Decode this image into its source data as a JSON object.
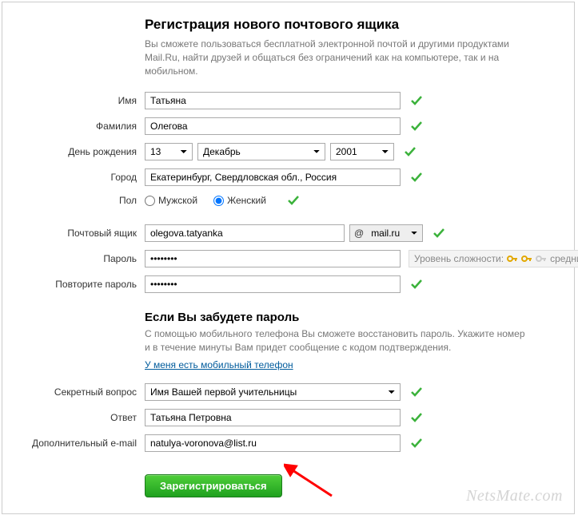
{
  "header": {
    "title": "Регистрация нового почтового ящика",
    "intro": "Вы сможете пользоваться бесплатной электронной почтой и другими продуктами Mail.Ru, найти друзей и общаться без ограничений как на компьютере, так и на мобильном."
  },
  "labels": {
    "first_name": "Имя",
    "last_name": "Фамилия",
    "birthday": "День рождения",
    "city": "Город",
    "gender": "Пол",
    "mailbox": "Почтовый ящик",
    "password": "Пароль",
    "password_repeat": "Повторите пароль",
    "secret_question": "Секретный вопрос",
    "answer": "Ответ",
    "extra_email": "Дополнительный e-mail"
  },
  "values": {
    "first_name": "Татьяна",
    "last_name": "Олегова",
    "day": "13",
    "month": "Декабрь",
    "year": "2001",
    "city": "Екатеринбург, Свердловская обл., Россия",
    "mailbox": "olegova.tatyanka",
    "domain_at": "@",
    "domain": "mail.ru",
    "password": "••••••••",
    "password_repeat": "••••••••",
    "secret_question": "Имя Вашей первой учительницы",
    "answer": "Татьяна Петровна",
    "extra_email": "natulya-voronova@list.ru"
  },
  "gender": {
    "male": "Мужской",
    "female": "Женский",
    "selected": "female"
  },
  "forgot": {
    "title": "Если Вы забудете пароль",
    "text": "С помощью мобильного телефона Вы сможете восстановить пароль. Укажите номер и в течение минуты Вам придет сообщение с кодом подтверждения.",
    "link": "У меня есть мобильный телефон"
  },
  "pw_strength": {
    "label": "Уровень сложности:",
    "value": "средний"
  },
  "buttons": {
    "register": "Зарегистрироваться"
  },
  "watermark": "NetsMate.com"
}
